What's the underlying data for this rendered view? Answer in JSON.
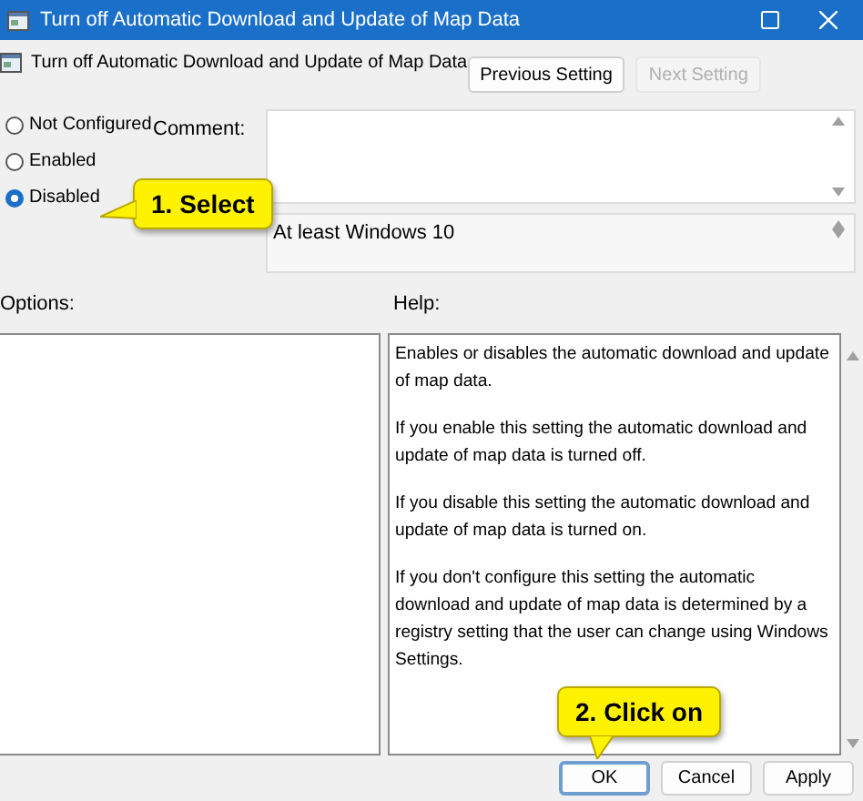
{
  "window": {
    "title": "Turn off Automatic Download and Update of Map Data"
  },
  "setting_title": "Turn off Automatic Download and Update of Map Data",
  "nav_buttons": [
    {
      "label": "Previous Setting",
      "disabled": false
    },
    {
      "label": "Next Setting",
      "disabled": true
    }
  ],
  "radios": [
    {
      "label": "Not Configured",
      "selected": false
    },
    {
      "label": "Enabled",
      "selected": false
    },
    {
      "label": "Disabled",
      "selected": true
    }
  ],
  "comment": {
    "label": "Comment:"
  },
  "supported_on": {
    "value": "At least Windows 10"
  },
  "options": {
    "label": "Options:"
  },
  "help": {
    "label": "Help:",
    "paragraphs": [
      "Enables or disables the automatic download and update of map data.",
      "If you enable this setting the automatic download and update of map data is turned off.",
      "If you disable this setting the automatic download and update of map data is turned on.",
      "If you don't configure this setting the automatic download and update of map data is determined by a registry setting that the user can change using Windows Settings."
    ]
  },
  "buttons": [
    {
      "label": "OK",
      "focused": true
    },
    {
      "label": "Cancel",
      "focused": false
    },
    {
      "label": "Apply",
      "focused": false
    }
  ],
  "callouts": [
    {
      "text": "1. Select",
      "kind": "left"
    },
    {
      "text": "2. Click on",
      "kind": "down"
    }
  ]
}
